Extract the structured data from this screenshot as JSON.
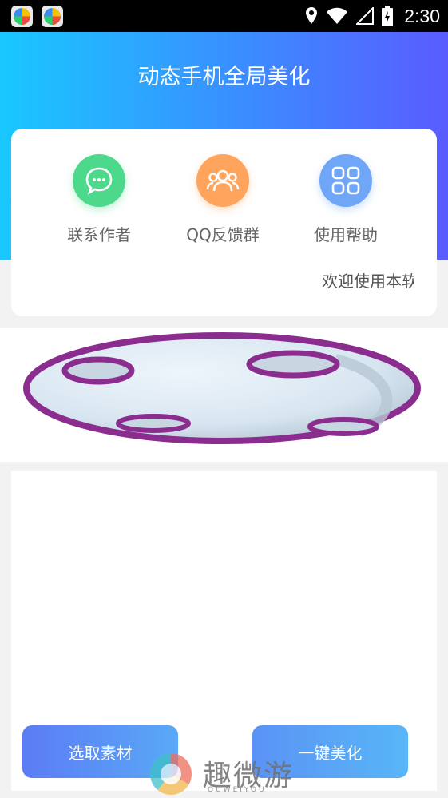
{
  "status_bar": {
    "time": "2:30",
    "icons": [
      "app-icon",
      "app-icon",
      "location-icon",
      "wifi-icon",
      "signal-icon",
      "battery-icon"
    ]
  },
  "header": {
    "title": "动态手机全局美化"
  },
  "shortcuts": [
    {
      "label": "联系作者",
      "icon": "chat-icon",
      "color": "#4cd98c"
    },
    {
      "label": "QQ反馈群",
      "icon": "group-icon",
      "color": "#ffa45c"
    },
    {
      "label": "使用帮助",
      "icon": "grid-icon",
      "color": "#6fa6f8"
    }
  ],
  "notice": {
    "text": "欢迎使用本软"
  },
  "actions": {
    "select_label": "选取素材",
    "beautify_label": "一键美化"
  },
  "watermark": {
    "text": "趣微游",
    "sub": "QUWEIYOU"
  },
  "colors": {
    "gradient_start": "#19c8ff",
    "gradient_end": "#5a5cff",
    "button_blue": "#5a93f6"
  }
}
